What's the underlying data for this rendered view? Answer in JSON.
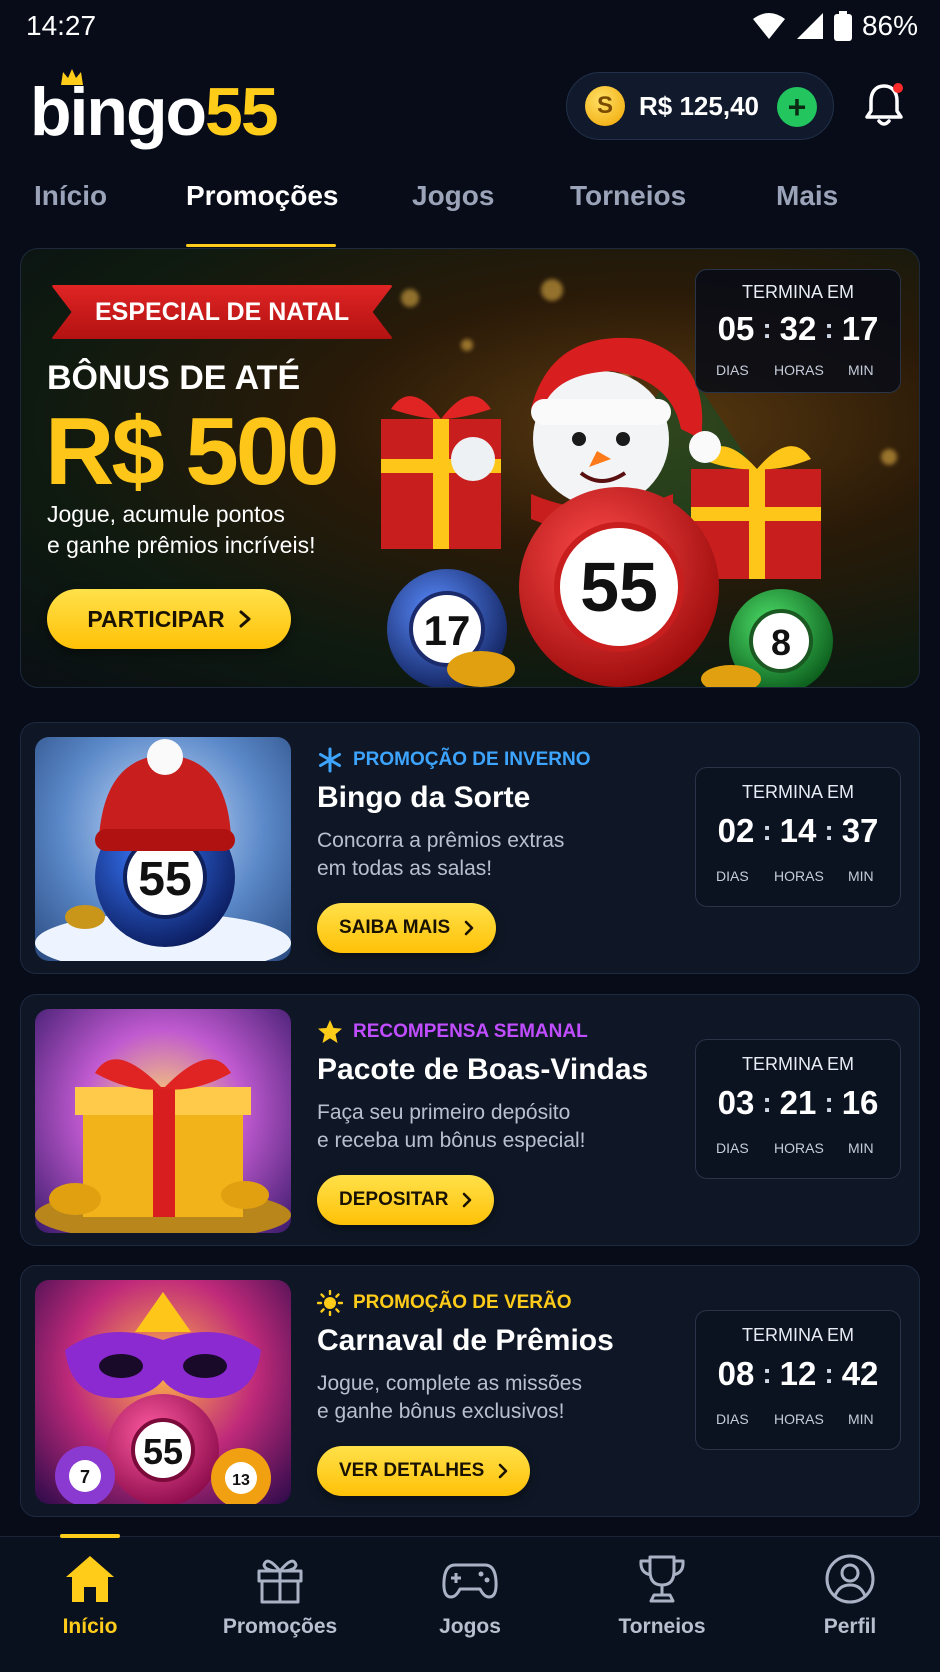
{
  "status_bar": {
    "time": "14:27",
    "battery": "86%"
  },
  "header": {
    "logo_text": "bingo",
    "logo_number": "55",
    "wallet_balance": "R$ 125,40",
    "coin_symbol": "S"
  },
  "tabs": [
    {
      "label": "Início",
      "active": false
    },
    {
      "label": "Promoções",
      "active": true
    },
    {
      "label": "Jogos",
      "active": false
    },
    {
      "label": "Torneios",
      "active": false
    },
    {
      "label": "Mais",
      "active": false
    }
  ],
  "hero": {
    "ribbon": "ESPECIAL DE NATAL",
    "subtitle": "BÔNUS DE ATÉ",
    "amount": "R$ 500",
    "description_line1": "Jogue, acumule pontos",
    "description_line2": "e ganhe prêmios incríveis!",
    "button_label": "PARTICIPAR",
    "ball_main": "55",
    "ball_left": "17",
    "ball_right": "8",
    "timer": {
      "title": "TERMINA EM",
      "days": "05",
      "hours": "32",
      "minutes": "17",
      "days_label": "DIAS",
      "hours_label": "HORAS",
      "minutes_label": "MIN"
    }
  },
  "promos": [
    {
      "category": "PROMOÇÃO DE INVERNO",
      "category_color": "#3da5ff",
      "icon": "snowflake-icon",
      "title": "Bingo da Sorte",
      "desc_line1": "Concorra a prêmios extras",
      "desc_line2": "em todas as salas!",
      "button_label": "SAIBA MAIS",
      "ball_number": "55",
      "timer": {
        "title": "TERMINA EM",
        "days": "02",
        "hours": "14",
        "minutes": "37",
        "days_label": "DIAS",
        "hours_label": "HORAS",
        "minutes_label": "MIN"
      }
    },
    {
      "category": "RECOMPENSA SEMANAL",
      "category_color": "#c04dff",
      "icon": "star-icon",
      "title": "Pacote de Boas-Vindas",
      "desc_line1": "Faça seu primeiro depósito",
      "desc_line2": "e receba um bônus especial!",
      "button_label": "DEPOSITAR",
      "timer": {
        "title": "TERMINA EM",
        "days": "03",
        "hours": "21",
        "minutes": "16",
        "days_label": "DIAS",
        "hours_label": "HORAS",
        "minutes_label": "MIN"
      }
    },
    {
      "category": "PROMOÇÃO DE VERÃO",
      "category_color": "#ffcc1a",
      "icon": "sun-icon",
      "title": "Carnaval de Prêmios",
      "desc_line1": "Jogue, complete as missões",
      "desc_line2": "e ganhe bônus exclusivos!",
      "button_label": "VER DETALHES",
      "ball_main": "55",
      "ball_left": "7",
      "ball_right": "13",
      "timer": {
        "title": "TERMINA EM",
        "days": "08",
        "hours": "12",
        "minutes": "42",
        "days_label": "DIAS",
        "hours_label": "HORAS",
        "minutes_label": "MIN"
      }
    }
  ],
  "bottom_nav": [
    {
      "label": "Início",
      "icon": "home-icon",
      "active": true
    },
    {
      "label": "Promoções",
      "icon": "gift-icon",
      "active": false
    },
    {
      "label": "Jogos",
      "icon": "gamepad-icon",
      "active": false
    },
    {
      "label": "Torneios",
      "icon": "trophy-icon",
      "active": false
    },
    {
      "label": "Perfil",
      "icon": "user-icon",
      "active": false
    }
  ],
  "colors": {
    "accent": "#ffcc1a",
    "background": "#070c18",
    "card": "#0f1726"
  }
}
